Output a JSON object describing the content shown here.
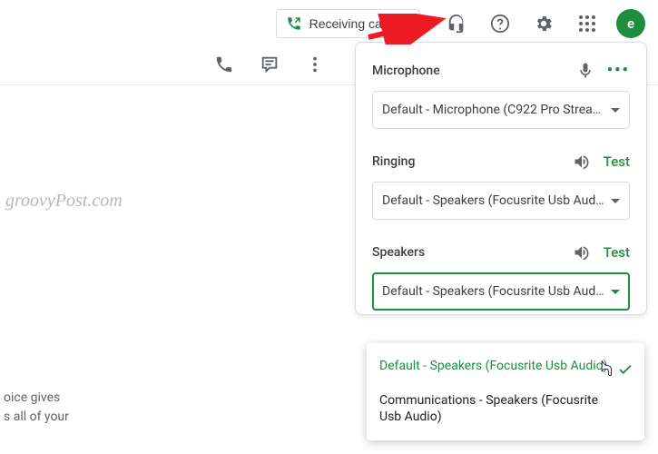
{
  "topbar": {
    "calls_button": "Receiving calls",
    "avatar_letter": "e"
  },
  "watermark": "groovyPost.com",
  "left_lines": {
    "l1": "oice gives",
    "l2": "s all of your"
  },
  "panel": {
    "mic": {
      "label": "Microphone",
      "value": "Default - Microphone (C922 Pro Strea…"
    },
    "ring": {
      "label": "Ringing",
      "test": "Test",
      "value": "Default - Speakers (Focusrite Usb Aud…"
    },
    "spk": {
      "label": "Speakers",
      "test": "Test",
      "value": "Default - Speakers (Focusrite Usb Aud…"
    }
  },
  "dropdown": {
    "opt1": "Default - Speakers (Focusrite Usb Audio)",
    "opt2": "Communications - Speakers (Focusrite Usb Audio)"
  }
}
